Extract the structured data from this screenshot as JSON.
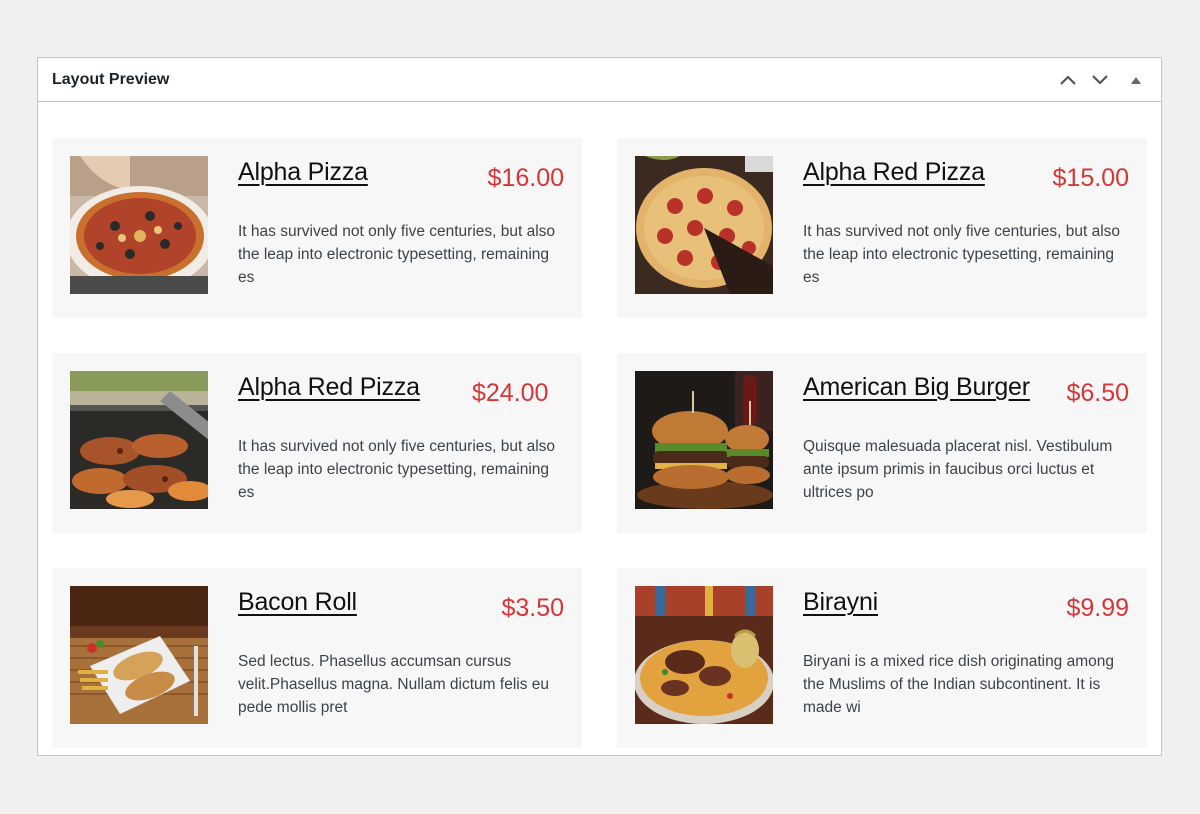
{
  "postbox": {
    "title": "Layout Preview",
    "move_up_label": "Move up",
    "move_down_label": "Move down",
    "toggle_label": "Toggle panel"
  },
  "items": [
    {
      "title": "Alpha Pizza",
      "price": "$16.00",
      "description": "It has survived not only five centuries, but also the leap into electronic typesetting, remaining es",
      "image": "pizza-photo"
    },
    {
      "title": "Alpha Red Pizza",
      "price": "$15.00",
      "description": "It has survived not only five centuries, but also the leap into electronic typesetting, remaining es",
      "image": "pepperoni-pizza-photo"
    },
    {
      "title": "Alpha Red Pizza",
      "price": "$24.00",
      "description": "It has survived not only five centuries, but also the leap into electronic typesetting, remaining es",
      "image": "grilled-meat-photo"
    },
    {
      "title": "American Big Burger",
      "price": "$6.50",
      "description": "Quisque malesuada placerat nisl. Vestibulum ante ipsum primis in faucibus orci luctus et ultrices po",
      "image": "burger-photo"
    },
    {
      "title": "Bacon Roll",
      "price": "$3.50",
      "description": "Sed lectus. Phasellus accumsan cursus velit.Phasellus magna. Nullam dictum felis eu pede mollis pret",
      "image": "bacon-roll-photo"
    },
    {
      "title": "Birayni",
      "price": "$9.99",
      "description": "Biryani is a mixed rice dish originating among the Muslims of the Indian subcontinent. It is made wi",
      "image": "biryani-photo"
    }
  ],
  "colors": {
    "price": "#d63638",
    "card_background": "#f7f7f7",
    "page_background": "#f0f0f1"
  }
}
